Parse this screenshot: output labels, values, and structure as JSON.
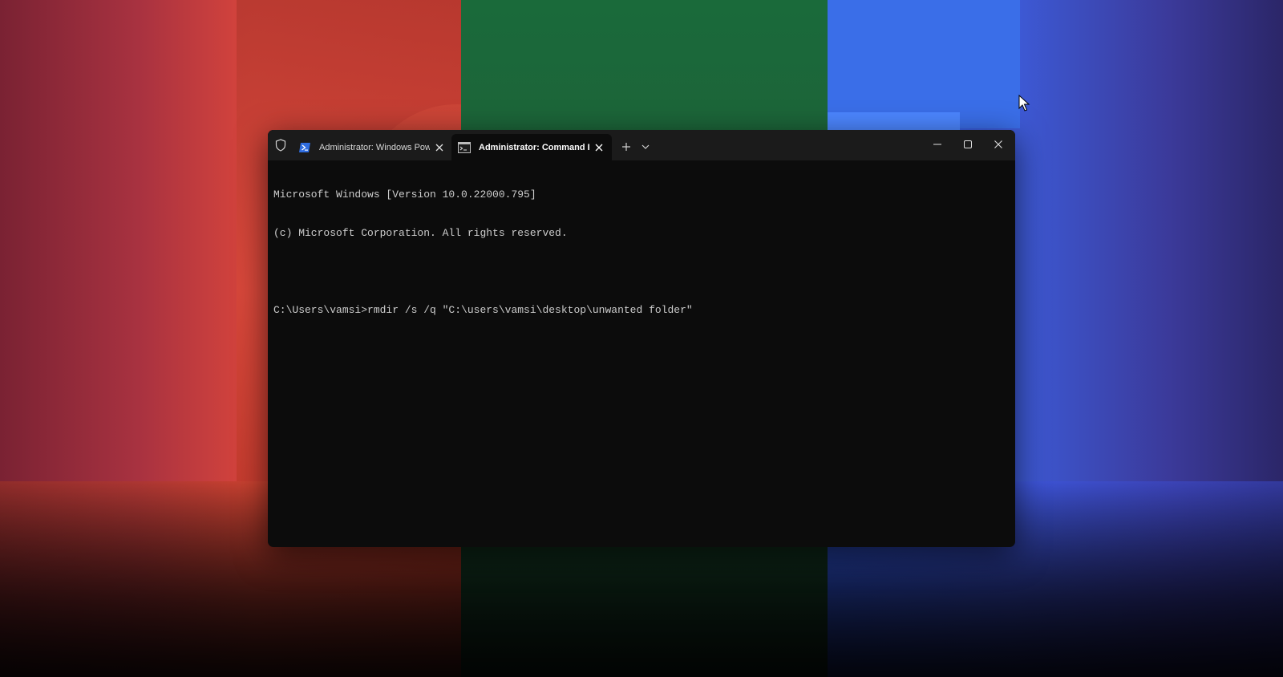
{
  "window": {
    "tabs": [
      {
        "label": "Administrator: Windows PowerShell",
        "icon": "powershell-icon",
        "active": false
      },
      {
        "label": "Administrator: Command Prompt",
        "icon": "cmd-icon",
        "active": true
      }
    ],
    "new_tab_icon": "plus-icon",
    "dropdown_icon": "chevron-down-icon",
    "controls": {
      "minimize": "minimize-icon",
      "maximize": "maximize-icon",
      "close": "close-icon"
    }
  },
  "console": {
    "lines": [
      "Microsoft Windows [Version 10.0.22000.795]",
      "(c) Microsoft Corporation. All rights reserved.",
      "",
      "C:\\Users\\vamsi>rmdir /s /q \"C:\\users\\vamsi\\desktop\\unwanted folder\""
    ]
  },
  "colors": {
    "terminal_bg": "#0c0c0c",
    "titlebar_bg": "#1b1b1b",
    "text": "#cccccc"
  }
}
